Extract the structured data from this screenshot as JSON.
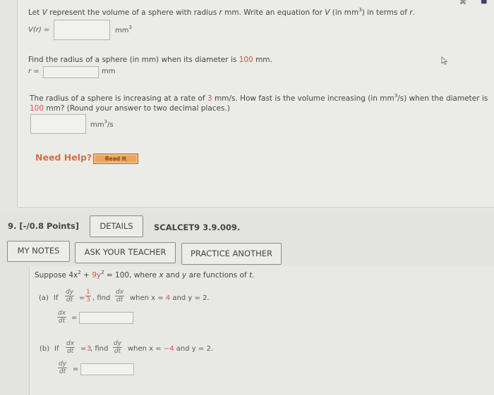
{
  "part1": {
    "prompt_pre": "Let ",
    "prompt_V": "V",
    "prompt_mid": " represent the volume of a sphere with radius ",
    "prompt_r": "r",
    "prompt_mid2": " mm. Write an equation for ",
    "prompt_V2": "V",
    "prompt_unit": " (in mm",
    "prompt_unit_sup": "3",
    "prompt_end": ") in terms of ",
    "prompt_r2": "r",
    "prompt_dot": ".",
    "label": "V(r) =",
    "answer": "",
    "unit": "mm",
    "unit_sup": "3"
  },
  "part2": {
    "prompt_pre": "Find the radius of a sphere (in mm) when its diameter is ",
    "prompt_value": "100",
    "prompt_post": " mm.",
    "label": "r =",
    "answer": "",
    "unit": "mm"
  },
  "part3": {
    "line1_pre": "The radius of a sphere is increasing at a rate of ",
    "line1_rate": "3",
    "line1_mid": " mm/s. How fast is the volume increasing (in mm",
    "line1_sup": "3",
    "line1_end": "/s) when the diameter is",
    "line2_value": "100",
    "line2_post": " mm? (Round your answer to two decimal places.)",
    "answer": "",
    "unit": "mm",
    "unit_sup": "3",
    "unit_post": "/s"
  },
  "help": {
    "label": "Need Help?",
    "read_it": "Read It"
  },
  "question9": {
    "number": "9.",
    "points": "[-/0.8 Points]",
    "details_button": "DETAILS",
    "code": "SCALCET9 3.9.009.",
    "my_notes_button": "MY NOTES",
    "ask_teacher_button": "ASK YOUR TEACHER",
    "practice_button": "PRACTICE ANOTHER",
    "statement_pre": "Suppose 4x",
    "statement_sup1": "2",
    "statement_plus": " + ",
    "statement_9y": "9y",
    "statement_sup2": "2",
    "statement_eq": " = 100, where ",
    "statement_x": "x",
    "statement_and": " and ",
    "statement_y": "y",
    "statement_post": " are functions of ",
    "statement_t": "t",
    "statement_dot": ".",
    "part_a": {
      "label": "(a)",
      "if": "If",
      "given_num": "dy",
      "given_den": "dt",
      "eq": "=",
      "value_num": "1",
      "value_den": "3",
      "find": ", find",
      "find_num": "dx",
      "find_den": "dt",
      "when": "when x =",
      "x_value": "4",
      "and_y": "and y = 2.",
      "answer_num": "dx",
      "answer_den": "dt",
      "answer_eq": "=",
      "answer": ""
    },
    "part_b": {
      "label": "(b)",
      "if": "If",
      "given_num": "dx",
      "given_den": "dt",
      "eq": "=",
      "value": "3",
      "find": ", find",
      "find_num": "dy",
      "find_den": "dt",
      "when": "when x =",
      "x_value": "−4",
      "and_y": "and y = 2.",
      "answer_num": "dy",
      "answer_den": "dt",
      "answer_eq": "=",
      "answer": ""
    }
  }
}
